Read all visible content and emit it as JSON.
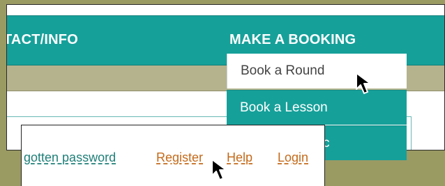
{
  "nav": {
    "contact_info": "TACT/INFO",
    "make_booking": "MAKE A BOOKING"
  },
  "dropdown": {
    "items": [
      {
        "label": "Book a Round",
        "state": "hovered"
      },
      {
        "label": "Book a Lesson",
        "state": "normal"
      },
      {
        "label": "c",
        "state": "partially-hidden"
      }
    ]
  },
  "login_panel": {
    "forgotten_password": "gotten password",
    "register": "Register",
    "help": "Help",
    "login": "Login"
  },
  "icons": {
    "cursor_top": "mouse-cursor-icon",
    "cursor_bottom": "mouse-cursor-icon"
  },
  "colors": {
    "primary_nav": "#16a09a",
    "subnav": "#b5b38e",
    "background": "#9a9a63",
    "link_orange": "#c46a1a",
    "link_teal": "#1f7f78"
  }
}
